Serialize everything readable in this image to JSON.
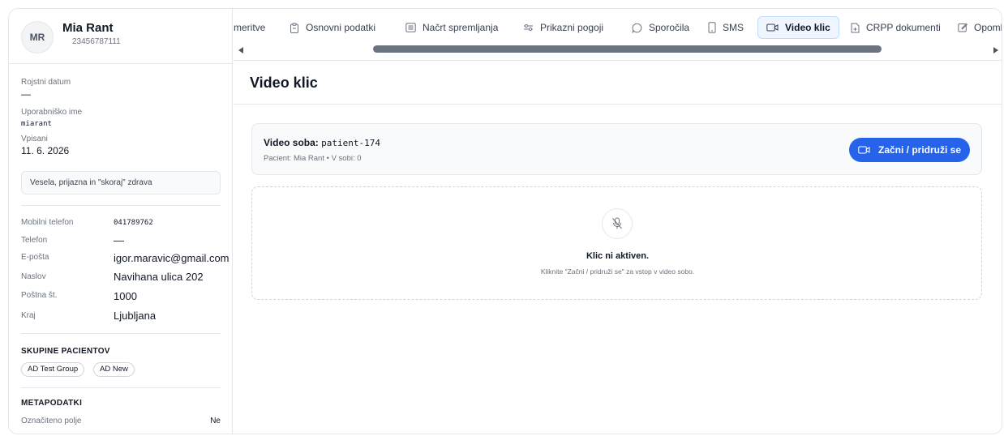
{
  "patient": {
    "initials": "MR",
    "name": "Mia Rant",
    "id": "23456787111"
  },
  "details": {
    "birth_label": "Rojstni datum",
    "birth_value": "—",
    "username_label": "Uporabniško ime",
    "username_value": "miarant",
    "enrolled_label": "Vpisani",
    "enrolled_value": "11. 6. 2026",
    "note": "Vesela, prijazna in \"skoraj\" zdrava"
  },
  "contact": [
    {
      "label": "Mobilni telefon",
      "value": "041789762"
    },
    {
      "label": "Telefon",
      "value": "—"
    },
    {
      "label": "E-pošta",
      "value": "igor.maravic@gmail.com"
    },
    {
      "label": "Naslov",
      "value": "Navihana ulica 202"
    },
    {
      "label": "Poštna št.",
      "value": "1000"
    },
    {
      "label": "Kraj",
      "value": "Ljubljana"
    }
  ],
  "groups": {
    "title": "SKUPINE PACIENTOV",
    "items": [
      "AD Test Group",
      "AD New"
    ]
  },
  "metadata": {
    "title": "METAPODATKI",
    "field_label": "Označiteno polje",
    "field_value": "Ne"
  },
  "tabs": [
    {
      "label": "meritve",
      "icon": "none"
    },
    {
      "label": "Osnovni podatki",
      "icon": "clipboard-icon"
    },
    {
      "label": "Načrt spremljanja",
      "icon": "list-icon"
    },
    {
      "label": "Prikazni pogoji",
      "icon": "sliders-icon"
    },
    {
      "label": "Sporočila",
      "icon": "chat-icon"
    },
    {
      "label": "SMS",
      "icon": "phone-icon"
    },
    {
      "label": "Video klic",
      "icon": "video-icon",
      "active": true
    },
    {
      "label": "CRPP dokumenti",
      "icon": "document-icon"
    },
    {
      "label": "Opomb",
      "icon": "edit-icon"
    }
  ],
  "main": {
    "title": "Video klic",
    "room_label": "Video soba:",
    "room_value": "patient-174",
    "room_sub": "Pacient: Mia Rant • V sobi: 0",
    "join_button": "Začni / pridruži se",
    "empty_title": "Klic ni aktiven.",
    "empty_sub": "Kliknite \"Začni / pridruži se\" za vstop v video sobo."
  },
  "colors": {
    "accent": "#2563eb",
    "active_tab_bg": "#eff6ff"
  }
}
